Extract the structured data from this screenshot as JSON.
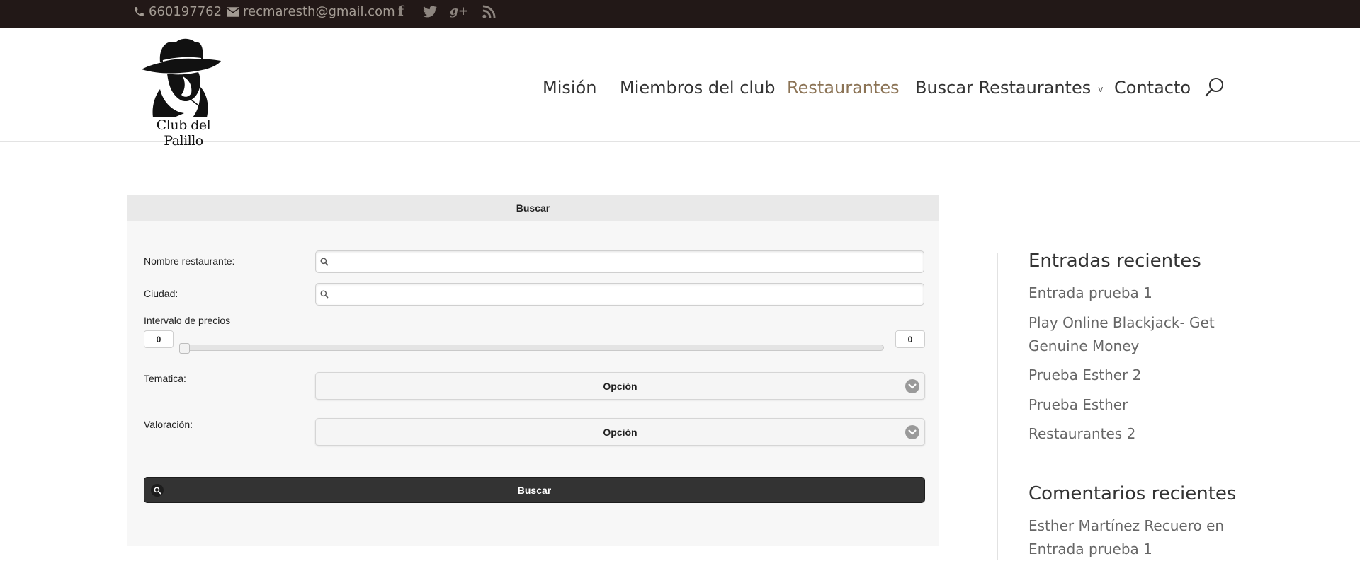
{
  "topbar": {
    "phone": "660197762",
    "email": "recmaresth@gmail.com",
    "social": {
      "facebook_glyph": "f",
      "googleplus_glyph": "g+"
    }
  },
  "header": {
    "logo_text": "Club del Palillo",
    "nav": {
      "mision": "Misión",
      "miembros": "Miembros del club",
      "restaurantes": "Restaurantes",
      "buscar": "Buscar Restaurantes",
      "buscar_chevron": "v",
      "contacto": "Contacto"
    },
    "active_color": "#8b7355"
  },
  "form": {
    "header": "Buscar",
    "nombre_label": "Nombre restaurante:",
    "nombre_value": "",
    "ciudad_label": "Ciudad:",
    "ciudad_value": "",
    "precio_label": "Intervalo de precios",
    "precio_min": "0",
    "precio_max": "0",
    "tematica_label": "Tematica:",
    "tematica_value": "Opción",
    "valoracion_label": "Valoración:",
    "valoracion_value": "Opción",
    "submit_label": "Buscar"
  },
  "sidebar": {
    "entradas_title": "Entradas recientes",
    "entradas": [
      "Entrada prueba 1",
      "Play Online Blackjack- Get Genuine Money",
      "Prueba Esther 2",
      "Prueba Esther",
      "Restaurantes 2"
    ],
    "comentarios_title": "Comentarios recientes",
    "comentarios": [
      "Esther Martínez Recuero en Entrada prueba 1"
    ]
  }
}
